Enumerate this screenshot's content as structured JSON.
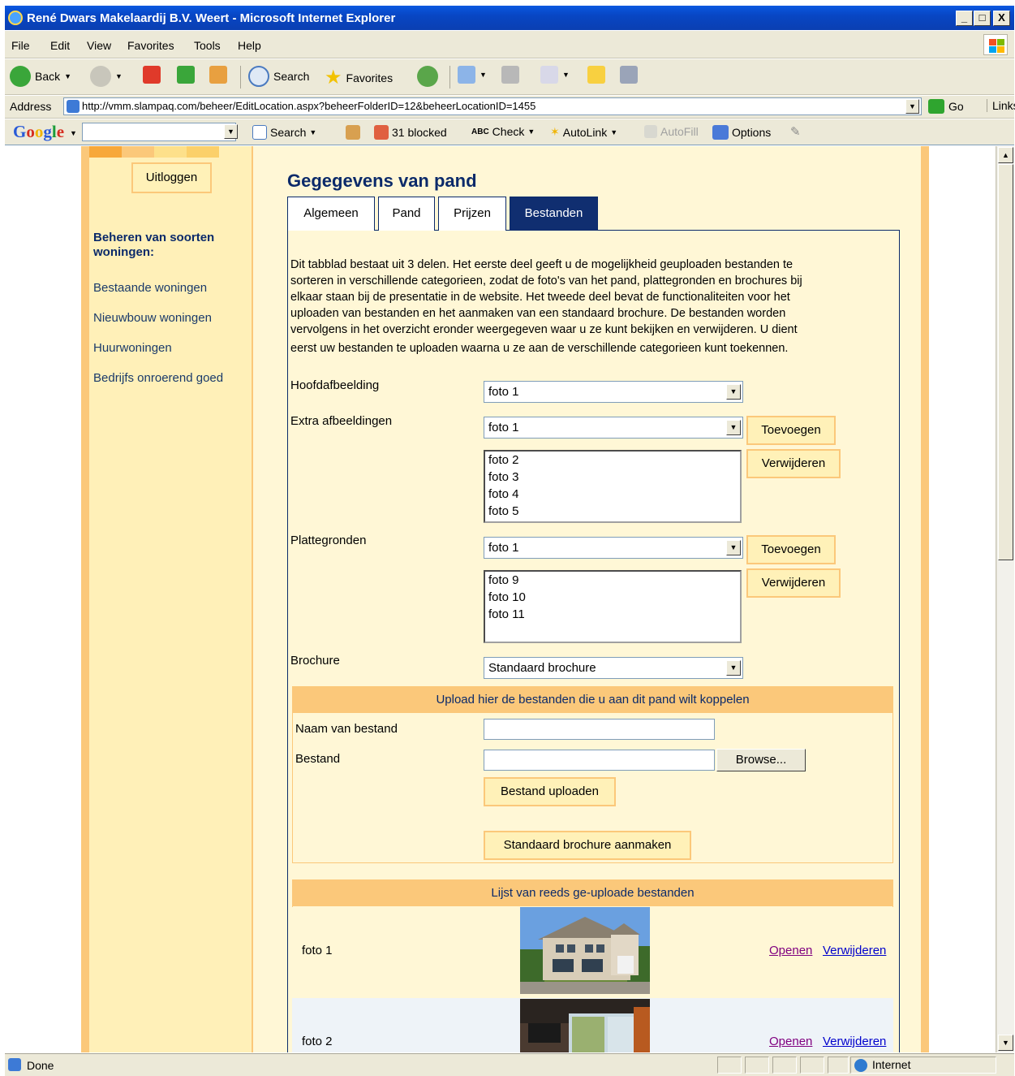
{
  "window": {
    "title": "René Dwars Makelaardij B.V. Weert - Microsoft Internet Explorer",
    "controls": [
      "_",
      "□",
      "X"
    ]
  },
  "menu": [
    "File",
    "Edit",
    "View",
    "Favorites",
    "Tools",
    "Help"
  ],
  "toolbar": {
    "back": "Back",
    "search": "Search",
    "favorites": "Favorites"
  },
  "address": {
    "label": "Address",
    "url": "http://vmm.slampaq.com/beheer/EditLocation.aspx?beheerFolderID=12&beheerLocationID=1455",
    "go": "Go",
    "links": "Links"
  },
  "google": {
    "logo": "Google",
    "search": "Search",
    "blocked": "31 blocked",
    "check": "Check",
    "autolink": "AutoLink",
    "autofill": "AutoFill",
    "options": "Options"
  },
  "sidebar": {
    "logout": "Uitloggen",
    "heading": "Beheren van soorten woningen:",
    "items": [
      "Bestaande woningen",
      "Nieuwbouw woningen",
      "Huurwoningen",
      "Bedrijfs onroerend goed"
    ]
  },
  "main": {
    "title": "Gegegevens van pand",
    "tabs": [
      "Algemeen",
      "Pand",
      "Prijzen",
      "Bestanden"
    ],
    "active_tab": "Bestanden",
    "description_lines": [
      "Dit tabblad bestaat uit 3 delen. Het eerste deel geeft u de mogelijkheid geuploaden bestanden te",
      "sorteren in verschillende categorieen, zodat de foto's van het pand, plattegronden en brochures bij",
      "elkaar staan bij de presentatie in de website. Het tweede deel bevat de functionaliteiten voor het",
      "uploaden van bestanden en het aanmaken van een standaard brochure. De bestanden worden",
      "vervolgens in het overzicht eronder weergegeven waar u ze kunt bekijken en verwijderen. U dient",
      "eerst uw bestanden te uploaden waarna u ze aan de verschillende categorieen kunt toekennen."
    ],
    "hoofdafbeelding": {
      "label": "Hoofdafbeelding",
      "selected": "foto 1"
    },
    "extra": {
      "label": "Extra afbeeldingen",
      "selected": "foto 1",
      "add": "Toevoegen",
      "remove": "Verwijderen",
      "list": [
        "foto 2",
        "foto 3",
        "foto 4",
        "foto 5"
      ]
    },
    "plattegronden": {
      "label": "Plattegronden",
      "selected": "foto 1",
      "add": "Toevoegen",
      "remove": "Verwijderen",
      "list": [
        "foto 9",
        "foto 10",
        "foto 11"
      ]
    },
    "brochure": {
      "label": "Brochure",
      "selected": "Standaard brochure"
    },
    "upload": {
      "header": "Upload hier de bestanden die u aan dit pand wilt koppelen",
      "name_label": "Naam van bestand",
      "file_label": "Bestand",
      "browse": "Browse...",
      "upload_btn": "Bestand uploaden",
      "brochure_btn": "Standaard brochure aanmaken"
    },
    "files": {
      "header": "Lijst van reeds ge-uploade bestanden",
      "rows": [
        {
          "name": "foto 1",
          "open": "Openen",
          "delete": "Verwijderen"
        },
        {
          "name": "foto 2",
          "open": "Openen",
          "delete": "Verwijderen"
        }
      ]
    }
  },
  "status": {
    "text": "Done",
    "zone": "Internet"
  },
  "colors": {
    "accent": "#fbc87a",
    "navy": "#0b2a6a",
    "panel": "#fff7d6"
  }
}
